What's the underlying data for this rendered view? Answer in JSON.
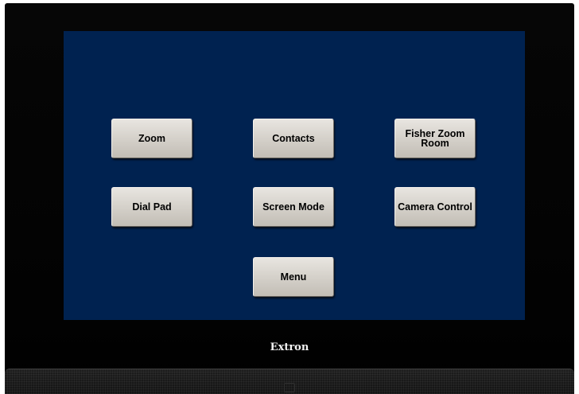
{
  "brand": "Extron",
  "buttons": {
    "zoom": "Zoom",
    "contacts": "Contacts",
    "fisher_zoom_room": "Fisher Zoom\nRoom",
    "dial_pad": "Dial Pad",
    "screen_mode": "Screen Mode",
    "camera_control": "Camera Control",
    "menu": "Menu"
  },
  "colors": {
    "screen_background": "#002250",
    "bezel": "#050505",
    "button_face": "#d3cfc8"
  }
}
